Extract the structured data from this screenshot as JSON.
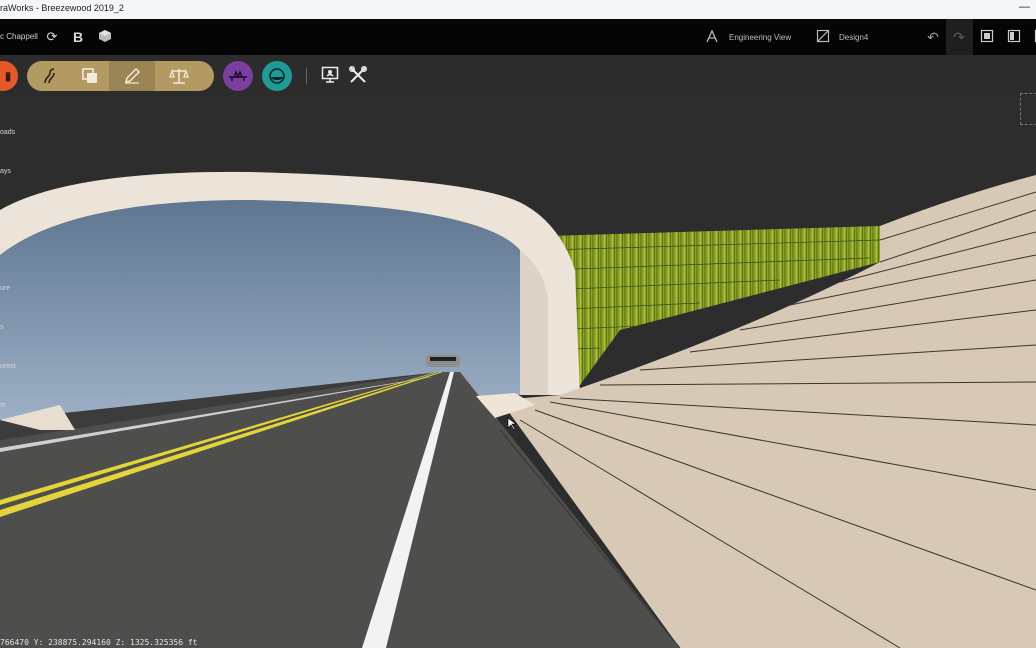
{
  "window": {
    "title": "raWorks - Breezewood 2019_2",
    "minimize": "—"
  },
  "topbar": {
    "user": "c Chappell",
    "bold_label": "B",
    "engineering_view": "Engineering View",
    "design": "Design4"
  },
  "sidebar": {
    "items": [
      "oads",
      "ays",
      "s",
      "ure",
      "s",
      "orest",
      "te"
    ]
  },
  "status": {
    "coords": "766470 Y: 238875.294160 Z: 1325.325356 ft"
  },
  "icons": {
    "refresh": "sync-icon",
    "layers": "cube-icon",
    "undo": "undo-icon",
    "redo": "redo-icon"
  },
  "colors": {
    "accent_pill": "#b39a63",
    "purple": "#7a3fa0",
    "teal": "#1f9a96",
    "orange": "#e4592a"
  }
}
